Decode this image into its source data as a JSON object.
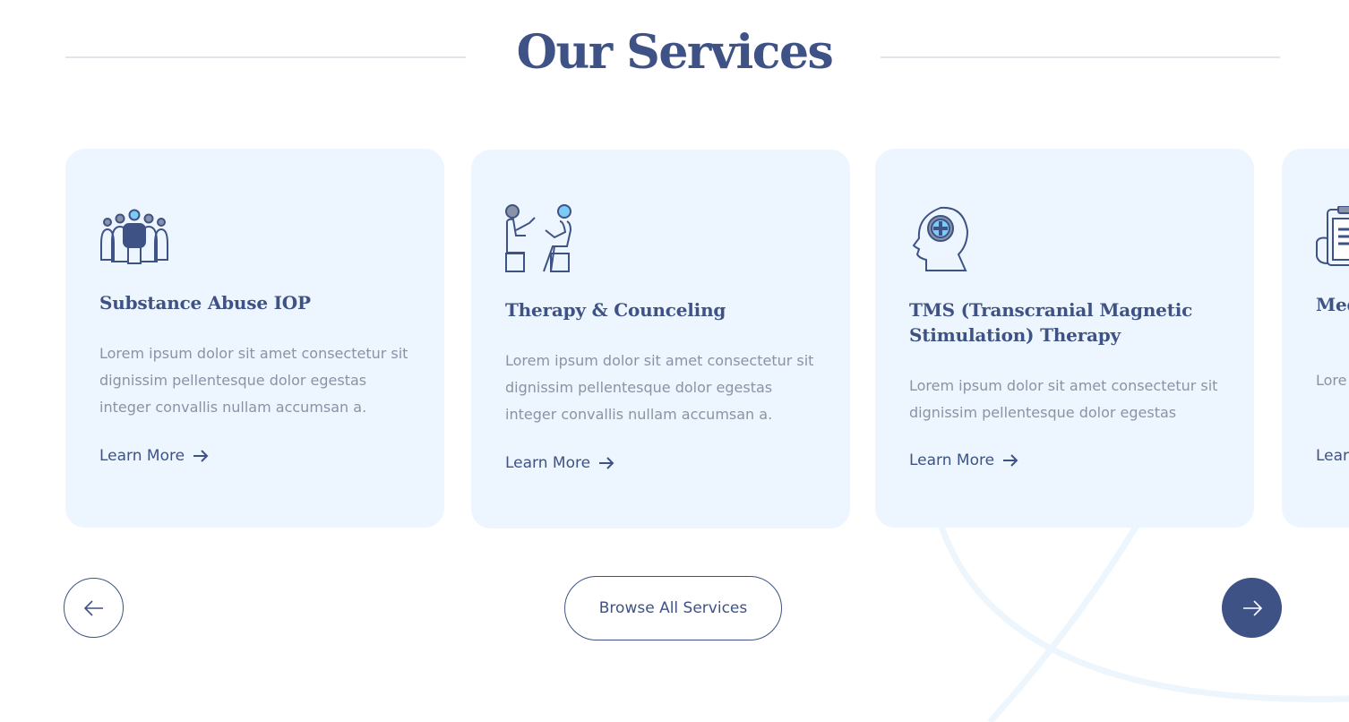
{
  "section": {
    "title": "Our Services"
  },
  "cards": [
    {
      "icon": "group-therapy-icon",
      "title": "Substance Abuse IOP",
      "description": "Lorem ipsum dolor sit amet consectetur sit dignissim pellentesque dolor egestas integer convallis nullam accumsan a.",
      "link_label": "Learn More"
    },
    {
      "icon": "counseling-session-icon",
      "title": "Therapy & Counceling",
      "description": "Lorem ipsum dolor sit amet consectetur sit dignissim pellentesque dolor egestas integer convallis nullam accumsan a.",
      "link_label": "Learn More"
    },
    {
      "icon": "brain-stimulation-icon",
      "title": "TMS (Transcranial Magnetic Stimulation) Therapy",
      "description": "Lorem ipsum dolor sit amet consectetur sit dignissim pellentesque dolor egestas",
      "link_label": "Learn More"
    },
    {
      "icon": "medical-clipboard-icon",
      "title": "Med (MA",
      "description": "Lore sit di",
      "link_label": "Lear"
    }
  ],
  "controls": {
    "browse_label": "Browse All Services",
    "prev_icon": "arrow-left-icon",
    "next_icon": "arrow-right-icon"
  },
  "colors": {
    "primary": "#3e5286",
    "card_bg": "#edf6fe",
    "body_text": "#8a93a6",
    "accent": "#7ccbf6"
  }
}
